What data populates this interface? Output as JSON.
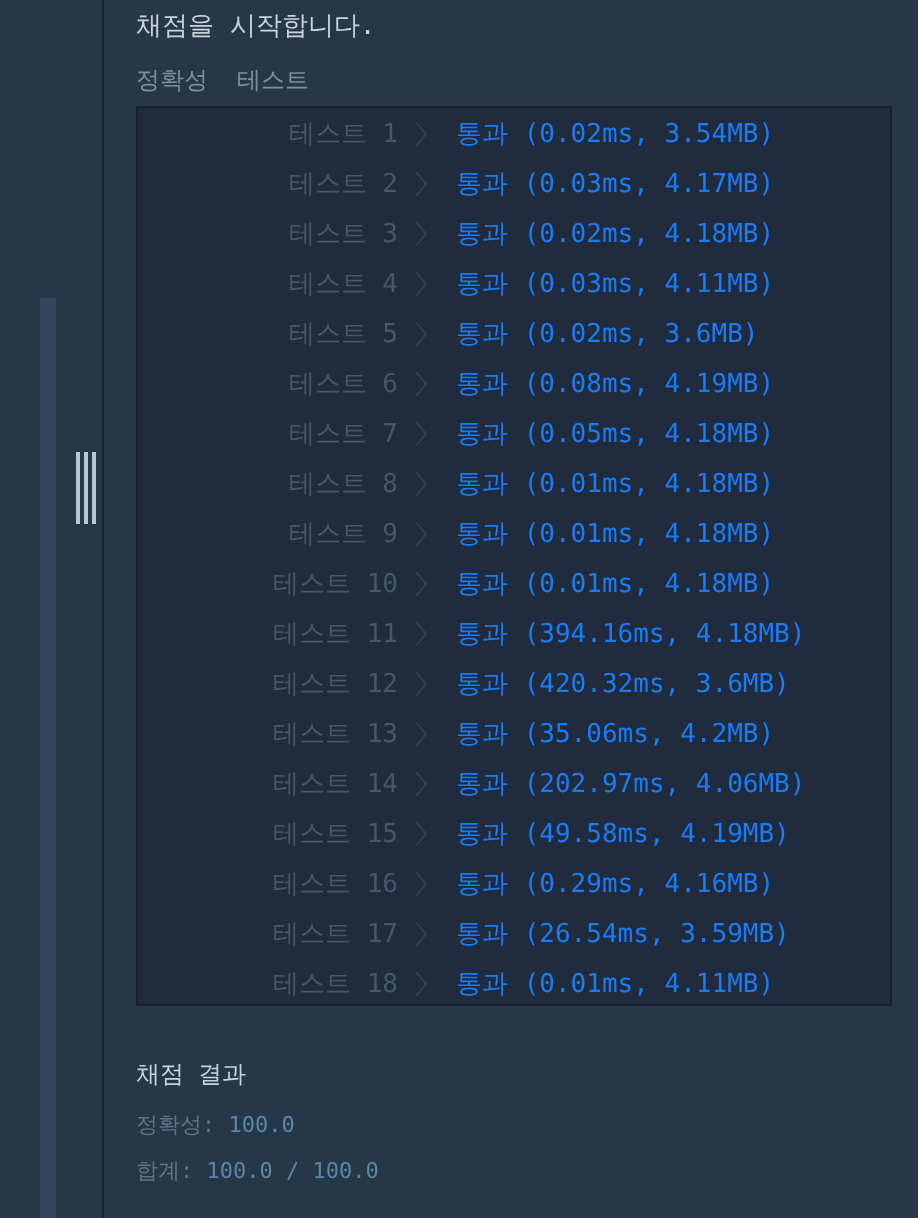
{
  "heading": "채점을 시작합니다.",
  "section_label": "정확성  테스트",
  "tests": [
    {
      "label": "테스트 1",
      "result": "통과 (0.02ms, 3.54MB)"
    },
    {
      "label": "테스트 2",
      "result": "통과 (0.03ms, 4.17MB)"
    },
    {
      "label": "테스트 3",
      "result": "통과 (0.02ms, 4.18MB)"
    },
    {
      "label": "테스트 4",
      "result": "통과 (0.03ms, 4.11MB)"
    },
    {
      "label": "테스트 5",
      "result": "통과 (0.02ms, 3.6MB)"
    },
    {
      "label": "테스트 6",
      "result": "통과 (0.08ms, 4.19MB)"
    },
    {
      "label": "테스트 7",
      "result": "통과 (0.05ms, 4.18MB)"
    },
    {
      "label": "테스트 8",
      "result": "통과 (0.01ms, 4.18MB)"
    },
    {
      "label": "테스트 9",
      "result": "통과 (0.01ms, 4.18MB)"
    },
    {
      "label": "테스트 10",
      "result": "통과 (0.01ms, 4.18MB)"
    },
    {
      "label": "테스트 11",
      "result": "통과 (394.16ms, 4.18MB)"
    },
    {
      "label": "테스트 12",
      "result": "통과 (420.32ms, 3.6MB)"
    },
    {
      "label": "테스트 13",
      "result": "통과 (35.06ms, 4.2MB)"
    },
    {
      "label": "테스트 14",
      "result": "통과 (202.97ms, 4.06MB)"
    },
    {
      "label": "테스트 15",
      "result": "통과 (49.58ms, 4.19MB)"
    },
    {
      "label": "테스트 16",
      "result": "통과 (0.29ms, 4.16MB)"
    },
    {
      "label": "테스트 17",
      "result": "통과 (26.54ms, 3.59MB)"
    },
    {
      "label": "테스트 18",
      "result": "통과 (0.01ms, 4.11MB)"
    }
  ],
  "summary": {
    "title": "채점 결과",
    "lines": [
      {
        "label": "정확성:",
        "value": "100.0"
      },
      {
        "label": "합계:",
        "value": "100.0 / 100.0"
      }
    ]
  }
}
